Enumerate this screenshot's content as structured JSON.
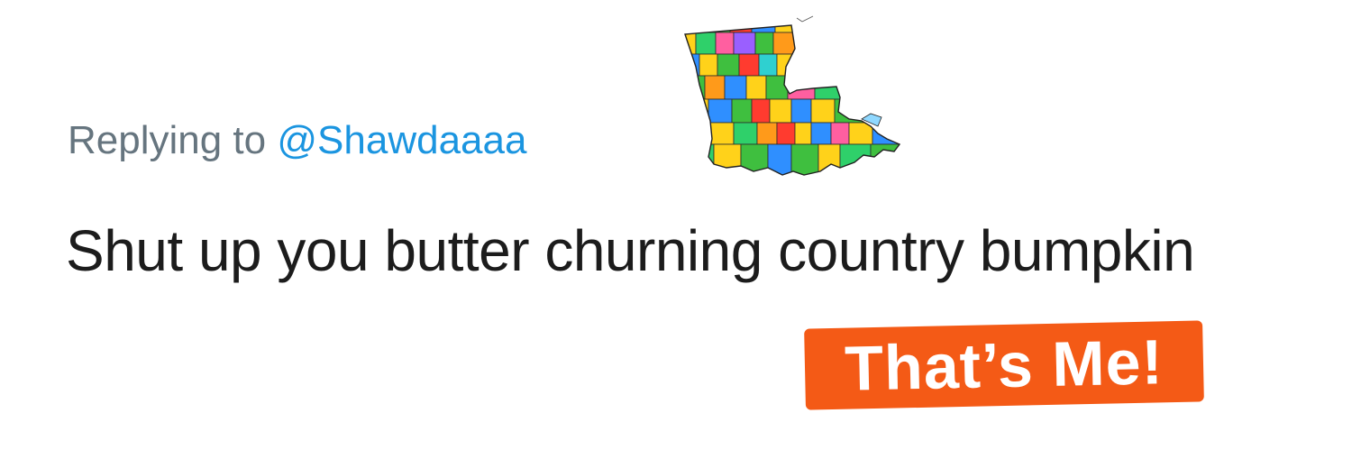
{
  "tweet": {
    "faded_header": "",
    "reply_prefix": "Replying to",
    "reply_handle": "@Shawdaaaa",
    "text": "Shut up you butter churning country bumpkin"
  },
  "overlay": {
    "badge_label": "That’s Me!",
    "badge_color": "#f45a16"
  },
  "colors": {
    "reply_gray": "#66757f",
    "handle_blue": "#1b95e0",
    "text": "#1c1c1c"
  },
  "sticker": {
    "icon": "louisiana-parish-map-icon"
  }
}
